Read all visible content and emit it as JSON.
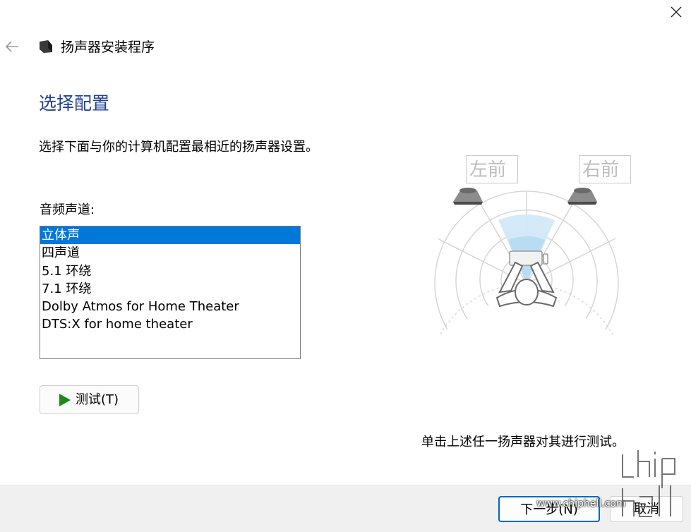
{
  "window": {
    "title": "扬声器安装程序",
    "back_icon": "arrow-left-icon",
    "close_icon": "close-icon",
    "app_icon": "speaker-icon"
  },
  "main": {
    "heading": "选择配置",
    "description": "选择下面与你的计算机配置最相近的扬声器设置。",
    "channels_label": "音频声道:",
    "channels": [
      {
        "label": "立体声",
        "selected": true
      },
      {
        "label": "四声道",
        "selected": false
      },
      {
        "label": "5.1 环绕",
        "selected": false
      },
      {
        "label": "7.1 环绕",
        "selected": false
      },
      {
        "label": "Dolby Atmos for Home Theater",
        "selected": false
      },
      {
        "label": "DTS:X for home theater",
        "selected": false
      }
    ],
    "test_button": "测试(T)",
    "test_icon": "play-icon",
    "hint": "单击上述任一扬声器对其进行测试。"
  },
  "diagram": {
    "left_front_label": "左前",
    "right_front_label": "右前"
  },
  "footer": {
    "next_button": "下一步(N)",
    "cancel_button": "取消"
  },
  "watermark": {
    "text": "www.chiphell.com",
    "logo_text": "chip hell"
  },
  "colors": {
    "heading": "#1f3f94",
    "selection": "#0078d7",
    "play": "#1a8a1a",
    "primary_border": "#0067c0"
  }
}
